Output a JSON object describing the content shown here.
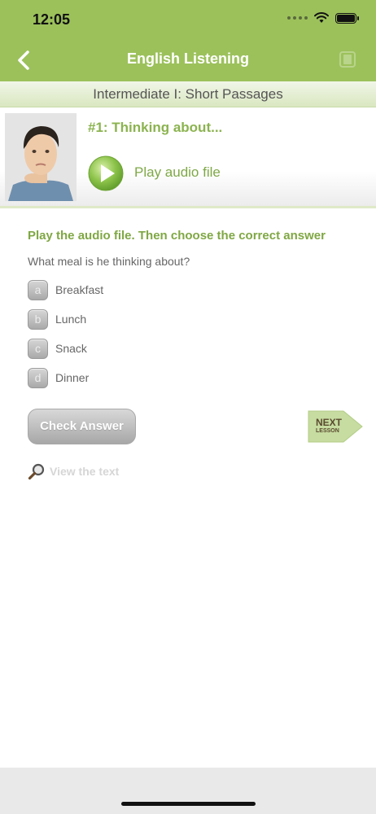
{
  "status_bar": {
    "time": "12:05"
  },
  "nav": {
    "title": "English Listening"
  },
  "subheader": {
    "text": "Intermediate I: Short Passages"
  },
  "lesson": {
    "title": "#1: Thinking about...",
    "play_label": "Play audio file"
  },
  "quiz": {
    "instruction": "Play the audio file. Then choose the correct answer",
    "question": "What meal is he thinking about?",
    "options": [
      {
        "letter": "a",
        "label": "Breakfast"
      },
      {
        "letter": "b",
        "label": "Lunch"
      },
      {
        "letter": "c",
        "label": "Snack"
      },
      {
        "letter": "d",
        "label": "Dinner"
      }
    ]
  },
  "actions": {
    "check_label": "Check Answer",
    "next_label": "NEXT",
    "next_sub_label": "LESSON",
    "view_text_label": "View the text"
  },
  "colors": {
    "accent_green": "#9cc15b",
    "title_green": "#8bb34f",
    "next_green": "#c6dca1"
  }
}
